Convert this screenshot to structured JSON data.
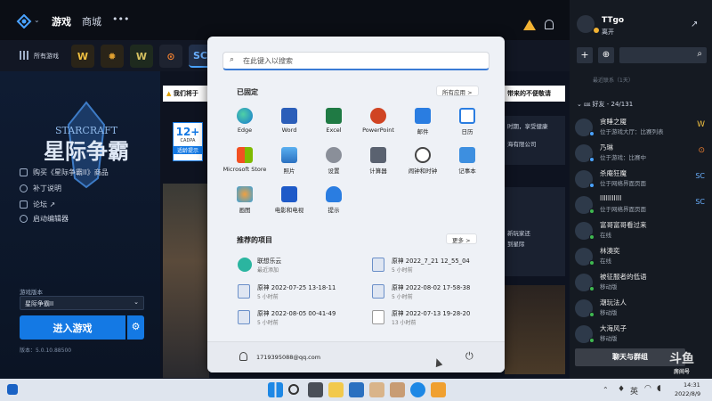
{
  "topbar": {
    "tab_games": "游戏",
    "tab_shop": "商城",
    "more": "•••"
  },
  "games_bar": {
    "all_games": "所有游戏"
  },
  "left": {
    "game_title_cn": "星际争霸",
    "game_title_en": "STARCRAFT",
    "menu": [
      "购买《星际争霸II》商品",
      "补丁说明",
      "论坛 ↗",
      "启动编辑器"
    ],
    "version_label": "游戏版本",
    "version_select": "星际争霸II",
    "play_button": "进入游戏",
    "version_number": "版本：5.0.10.88500"
  },
  "content": {
    "notice_left": "我们将于",
    "notice_right": "带来的不便敬请",
    "age_rating": "12+",
    "cadpa": "CADPA",
    "age_hint": "适龄提示",
    "side_text_1": "时期，享受健康",
    "side_text_2": "海有限公司",
    "side_text_3": "新玩家还",
    "side_text_4": "到星际"
  },
  "right": {
    "username": "TTgo",
    "status": "离开",
    "friends_header": "好友 - 24/131",
    "recent_hint": "最近联系（1天）",
    "chat_button": "聊天与群组",
    "friends": [
      {
        "name": "贪睡之魇",
        "status": "位于游戏大厅：比赛列表"
      },
      {
        "name": "乃琳",
        "status": "位于游戏：比赛中"
      },
      {
        "name": "杀庵狂魔",
        "status": "位于网络界面页面"
      },
      {
        "name": "IIIIIIIIIII",
        "status": "位于网络界面页面"
      },
      {
        "name": "富哥富哥看过来",
        "status": "在线"
      },
      {
        "name": "林澳奕",
        "status": "在线"
      },
      {
        "name": "被征服者的低语",
        "status": "移动版"
      },
      {
        "name": "潮玩法人",
        "status": "移动版"
      },
      {
        "name": "大海风子",
        "status": "移动版"
      }
    ]
  },
  "startmenu": {
    "search_placeholder": "在此键入以搜索",
    "pinned_title": "已固定",
    "all_apps": "所有应用  >",
    "pinned": [
      "Edge",
      "Word",
      "Excel",
      "PowerPoint",
      "邮件",
      "日历",
      "Microsoft Store",
      "照片",
      "设置",
      "计算器",
      "闹钟和时钟",
      "记事本",
      "画图",
      "电影和电视",
      "提示"
    ],
    "recommended_title": "推荐的项目",
    "more": "更多  >",
    "recommended": [
      {
        "name": "联想乐云",
        "time": "最近添加"
      },
      {
        "name": "原神 2022_7_21 12_55_04",
        "time": "5 小时前"
      },
      {
        "name": "原神 2022-07-25 13-18-11",
        "time": "5 小时前"
      },
      {
        "name": "原神 2022-08-02 17-58-38",
        "time": "5 小时前"
      },
      {
        "name": "原神 2022-08-05 00-41-49",
        "time": "5 小时前"
      },
      {
        "name": "原神 2022-07-13 19-28-20",
        "time": "13 小时前"
      }
    ],
    "user": "1719395088@qq.com"
  },
  "taskbar": {
    "ime": "英",
    "time": "14:31",
    "date": "2022/8/9"
  },
  "watermark": {
    "brand": "斗鱼",
    "sub": "房间号"
  },
  "colors": {
    "accent": "#1e88e5",
    "play_button": "#1479e4",
    "notice": "#f2c94c"
  }
}
